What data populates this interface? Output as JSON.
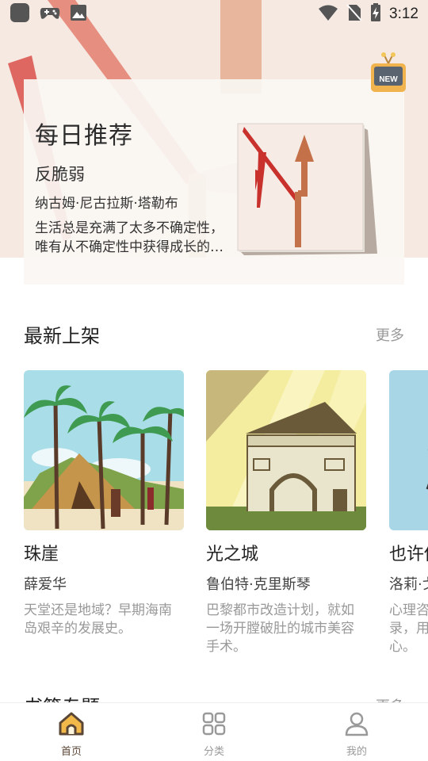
{
  "status_bar": {
    "time": "3:12",
    "left_icons": [
      "app-square-icon",
      "gamepad-icon",
      "image-icon"
    ],
    "right_icons": [
      "wifi-icon",
      "no-sim-icon",
      "battery-charging-icon"
    ]
  },
  "hero": {
    "title": "每日推荐",
    "book_title": "反脆弱",
    "author": "纳古姆·尼古拉斯·塔勒布",
    "description": "生活总是充满了太多不确定性，唯有从不确定性中获得成长的能力，才能在混乱中立于不败之地。",
    "badge": "NEW"
  },
  "new_arrivals": {
    "title": "最新上架",
    "more": "更多",
    "books": [
      {
        "title": "珠崖",
        "author": "薛爱华",
        "description": "天堂还是地域？早期海南岛艰辛的发展史。"
      },
      {
        "title": "光之城",
        "author": "鲁伯特·克里斯琴",
        "description": "巴黎都市改造计划，就如一场开膛破肚的城市美容手术。"
      },
      {
        "title": "也许你该找个人聊聊",
        "author": "洛莉·戈特利布",
        "description": "心理咨询师的一段治愈记录，用温暖的故事疗愈人心。"
      }
    ]
  },
  "topics": {
    "title": "书籍专题",
    "more": "更多"
  },
  "bottom_nav": [
    {
      "label": "首页",
      "icon": "home-icon",
      "active": true
    },
    {
      "label": "分类",
      "icon": "grid-icon",
      "active": false
    },
    {
      "label": "我的",
      "icon": "user-icon",
      "active": false
    }
  ],
  "colors": {
    "accent": "#5b4636",
    "home_icon_fill": "#f2b94a",
    "muted_text": "#999999",
    "hero_bg": "#f6e9e1"
  }
}
